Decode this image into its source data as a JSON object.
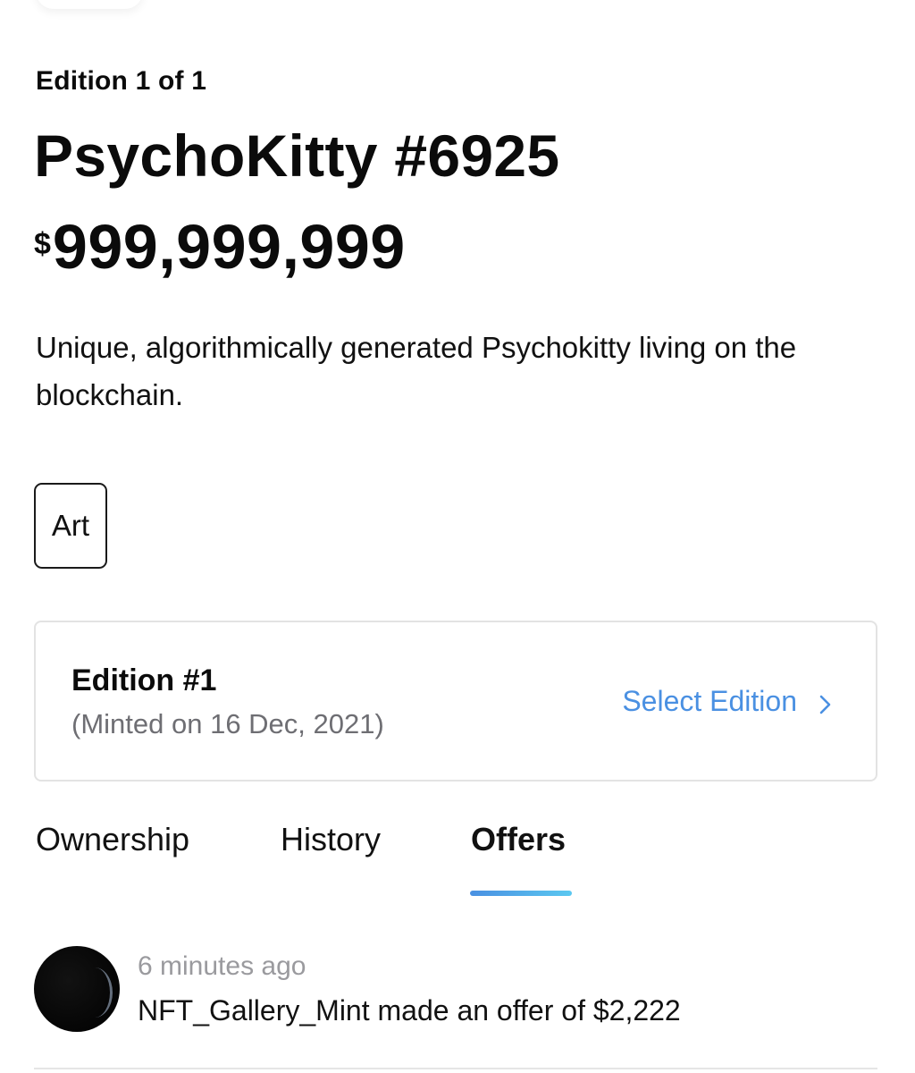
{
  "nft": {
    "edition_label": "Edition 1 of 1",
    "title": "PsychoKitty #6925",
    "price_currency": "$",
    "price_amount": "999,999,999",
    "description": "Unique, algorithmically generated Psychokitty living on the blockchain."
  },
  "tag": {
    "label": "Art"
  },
  "edition_card": {
    "edition_number": "Edition #1",
    "minted_on": "(Minted on 16 Dec, 2021)",
    "select_label": "Select Edition",
    "select_icon": "chevron-right-icon",
    "accent_color": "#4a90e2"
  },
  "tabs": [
    {
      "label": "Ownership",
      "active": false
    },
    {
      "label": "History",
      "active": false
    },
    {
      "label": "Offers",
      "active": true
    }
  ],
  "offers": [
    {
      "time": "6 minutes ago",
      "text": "NFT_Gallery_Mint made an offer of $2,222",
      "avatar_icon": "user-avatar"
    }
  ]
}
